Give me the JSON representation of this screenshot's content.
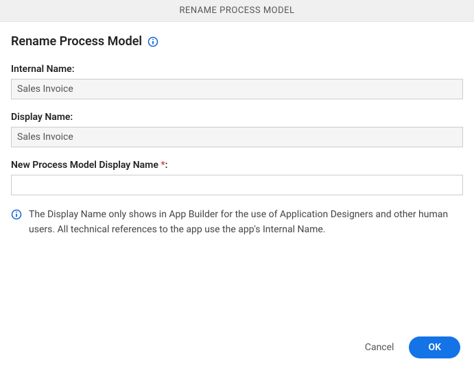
{
  "header": {
    "title": "RENAME PROCESS MODEL"
  },
  "page": {
    "title": "Rename Process Model"
  },
  "fields": {
    "internal_name": {
      "label": "Internal Name:",
      "value": "Sales Invoice"
    },
    "display_name": {
      "label": "Display Name:",
      "value": "Sales Invoice"
    },
    "new_display_name": {
      "label_prefix": "New Process Model Display Name ",
      "required_mark": "*",
      "label_suffix": ":",
      "value": ""
    }
  },
  "note": {
    "text": "The Display Name only shows in App Builder for the use of Application Designers and other human users. All technical references to the app use the app's Internal Name."
  },
  "footer": {
    "cancel_label": "Cancel",
    "ok_label": "OK"
  }
}
